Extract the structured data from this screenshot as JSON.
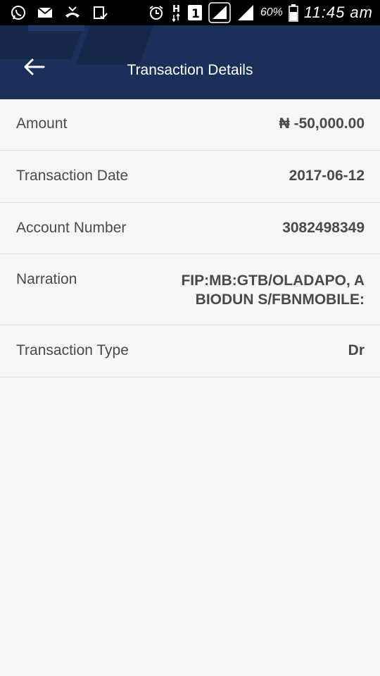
{
  "status_bar": {
    "battery": "60%",
    "time": "11:45 am",
    "icons": [
      "whatsapp-icon",
      "mail-icon",
      "missed-call-icon",
      "clipboard-check-icon",
      "alarm-icon",
      "h-network-icon",
      "sim-1-icon",
      "signal-icon",
      "signal-icon",
      "battery-icon"
    ]
  },
  "app_bar": {
    "title": "Transaction Details",
    "back_icon": "arrow-left-icon"
  },
  "details": {
    "amount": {
      "label": "Amount",
      "value": "₦ -50,000.00"
    },
    "date": {
      "label": "Transaction Date",
      "value": "2017-06-12"
    },
    "account": {
      "label": "Account Number",
      "value": "3082498349"
    },
    "narration": {
      "label": "Narration",
      "value": "FIP:MB:GTB/OLADAPO, ABIODUN S/FBNMOBILE:"
    },
    "type": {
      "label": "Transaction Type",
      "value": "Dr"
    }
  },
  "colors": {
    "app_bar": "#1b3058",
    "background": "#f6f6f6",
    "text": "#4a4a4a",
    "divider": "#e1e1e1"
  }
}
